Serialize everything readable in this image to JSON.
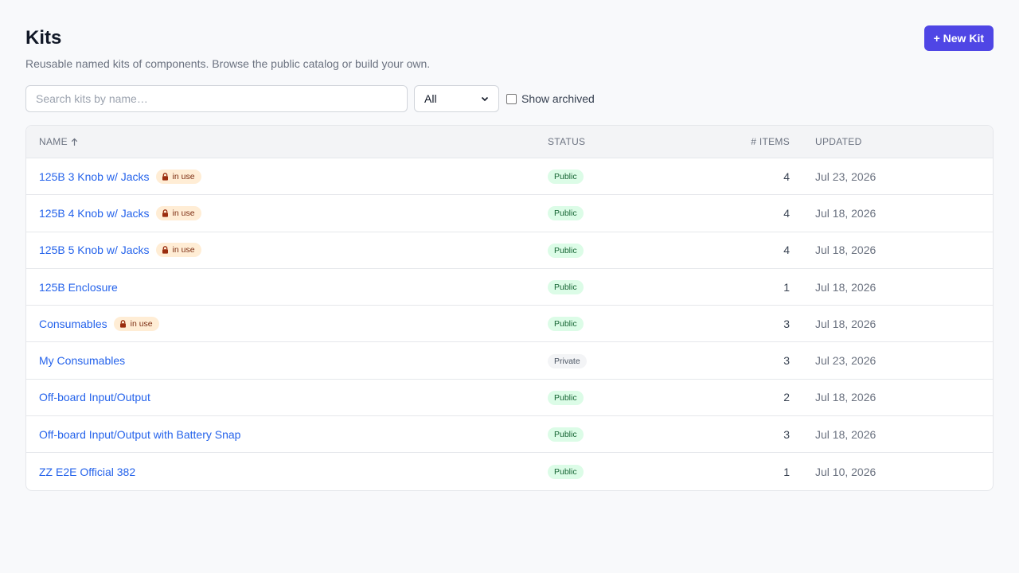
{
  "header": {
    "title": "Kits",
    "subtitle": "Reusable named kits of components. Browse the public catalog or build your own.",
    "new_button": "+ New Kit"
  },
  "toolbar": {
    "search_placeholder": "Search kits by name…",
    "filter_value": "All",
    "show_archived_label": "Show archived"
  },
  "table": {
    "columns": {
      "name": "NAME",
      "status": "STATUS",
      "items": "# ITEMS",
      "updated": "UPDATED"
    },
    "in_use_label": "in use",
    "rows": [
      {
        "name": "125B 3 Knob w/ Jacks",
        "in_use": true,
        "status": "Public",
        "items": "4",
        "updated": "Jul 23, 2026"
      },
      {
        "name": "125B 4 Knob w/ Jacks",
        "in_use": true,
        "status": "Public",
        "items": "4",
        "updated": "Jul 18, 2026"
      },
      {
        "name": "125B 5 Knob w/ Jacks",
        "in_use": true,
        "status": "Public",
        "items": "4",
        "updated": "Jul 18, 2026"
      },
      {
        "name": "125B Enclosure",
        "in_use": false,
        "status": "Public",
        "items": "1",
        "updated": "Jul 18, 2026"
      },
      {
        "name": "Consumables",
        "in_use": true,
        "status": "Public",
        "items": "3",
        "updated": "Jul 18, 2026"
      },
      {
        "name": "My Consumables",
        "in_use": false,
        "status": "Private",
        "items": "3",
        "updated": "Jul 23, 2026"
      },
      {
        "name": "Off-board Input/Output",
        "in_use": false,
        "status": "Public",
        "items": "2",
        "updated": "Jul 18, 2026"
      },
      {
        "name": "Off-board Input/Output with Battery Snap",
        "in_use": false,
        "status": "Public",
        "items": "3",
        "updated": "Jul 18, 2026"
      },
      {
        "name": "ZZ E2E Official 382",
        "in_use": false,
        "status": "Public",
        "items": "1",
        "updated": "Jul 10, 2026"
      }
    ]
  },
  "colors": {
    "accent": "#4f46e5",
    "link": "#2563eb",
    "public_badge_bg": "#dcfce7",
    "private_badge_bg": "#f3f4f6",
    "in_use_bg": "#ffedd5"
  },
  "icons": {
    "sort": "arrow-up-icon",
    "lock": "lock-icon",
    "select": "chevron-down-icon"
  }
}
